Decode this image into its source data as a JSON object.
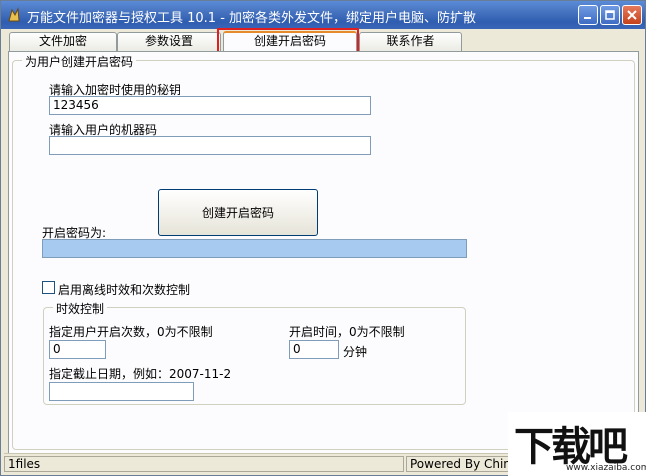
{
  "window": {
    "title": "万能文件加密器与授权工具 10.1 - 加密各类外发文件，绑定用户电脑、防扩散",
    "accent_color": "#3a66b8"
  },
  "tabs": [
    {
      "label": "文件加密"
    },
    {
      "label": "参数设置"
    },
    {
      "label": "创建开启密码",
      "active": true
    },
    {
      "label": "联系作者"
    }
  ],
  "create_group": {
    "legend": "为用户创建开启密码",
    "secret_key_label": "请输入加密时使用的秘钥",
    "secret_key_value": "123456",
    "machine_code_label": "请输入用户的机器码",
    "machine_code_value": "",
    "create_button_label": "创建开启密码",
    "result_label": "开启密码为:",
    "result_value": ""
  },
  "offline_control": {
    "checkbox_label": "启用离线时效和次数控制",
    "checked": false
  },
  "time_group": {
    "legend": "时效控制",
    "open_count_label": "指定用户开启次数，0为不限制",
    "open_count_value": "0",
    "open_time_label": "开启时间，0为不限制",
    "open_time_value": "0",
    "open_time_unit": "分钟",
    "expiry_label": "指定截止日期，例如：2007-11-2",
    "expiry_value": ""
  },
  "statusbar": {
    "files": "1files",
    "powered": "Powered By China"
  },
  "watermark": {
    "brand": "下载吧",
    "url": "www.xiazaiba.com"
  }
}
